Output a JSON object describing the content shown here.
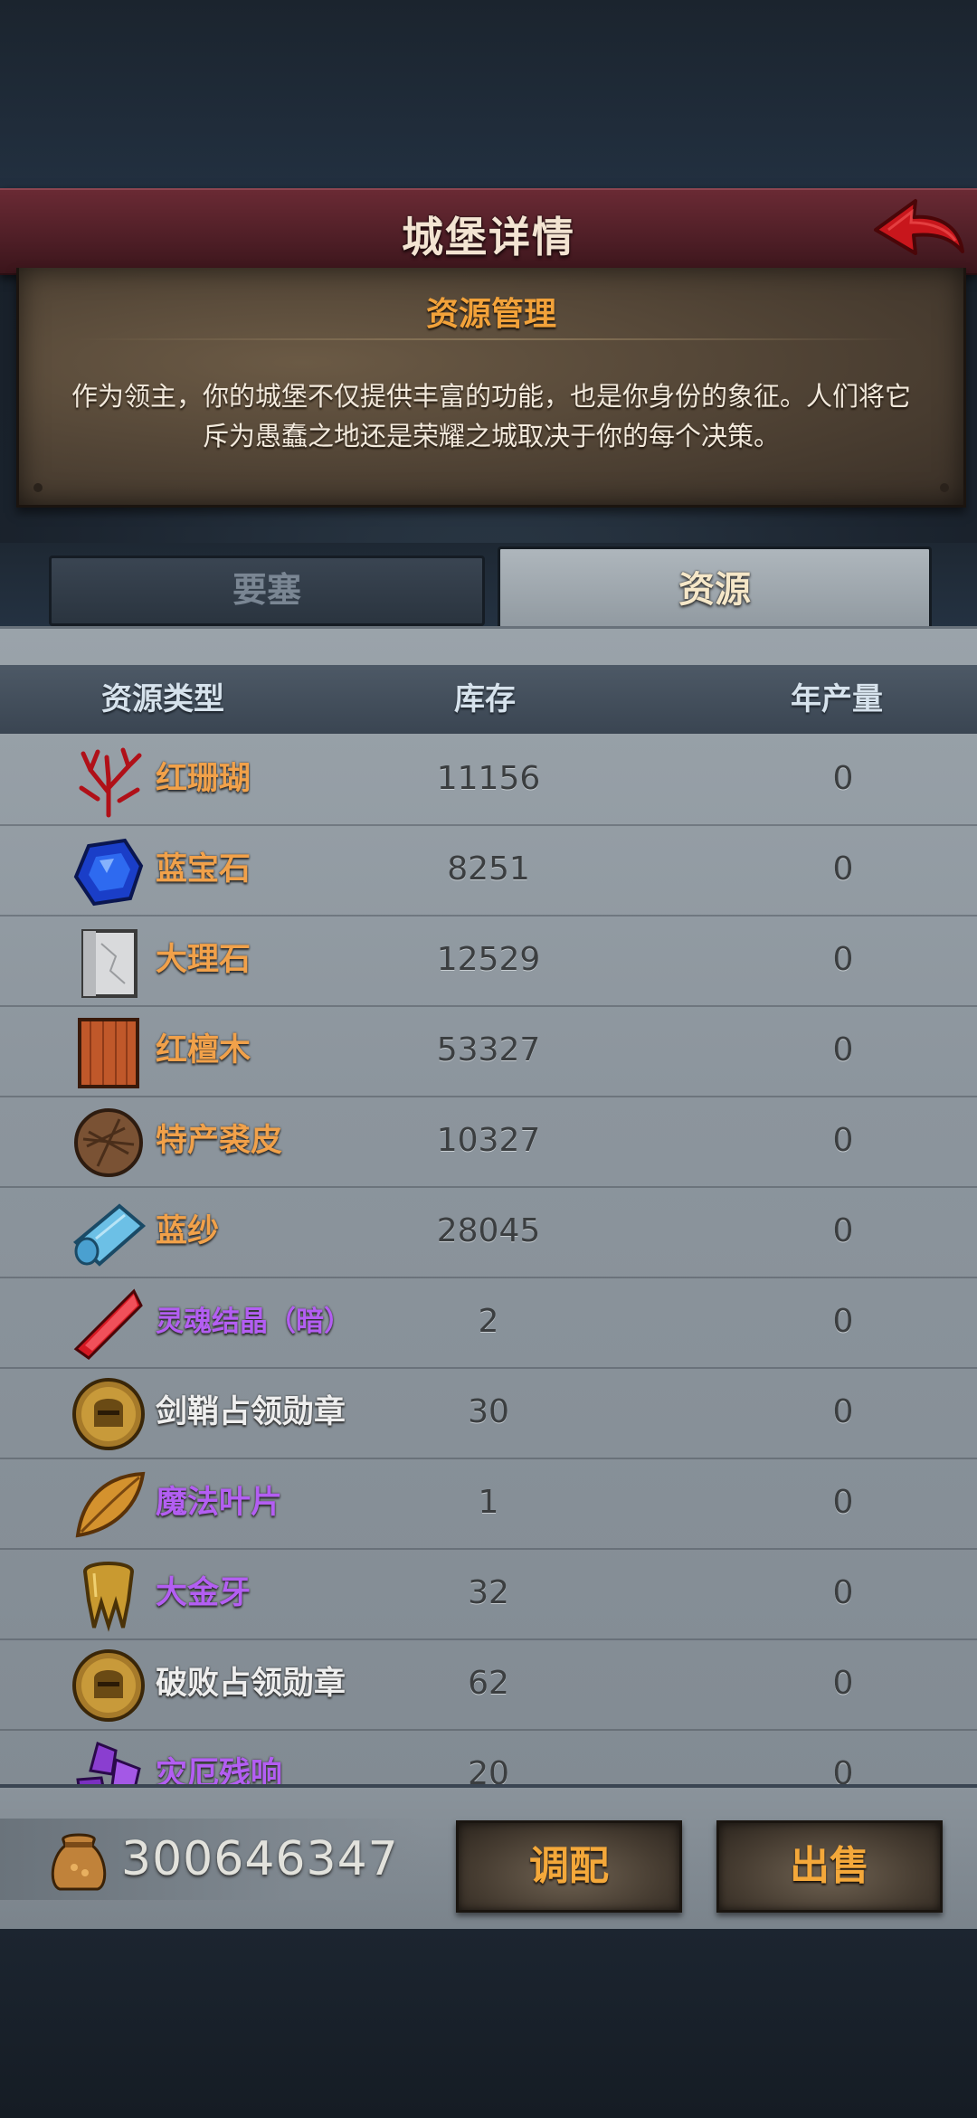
{
  "header": {
    "title": "城堡详情"
  },
  "banner": {
    "title": "资源管理",
    "description": "作为领主，你的城堡不仅提供丰富的功能，也是你身份的象征。人们将它斥为愚蠢之地还是荣耀之城取决于你的每个决策。"
  },
  "tabs": [
    {
      "label": "要塞",
      "active": false
    },
    {
      "label": "资源",
      "active": true
    }
  ],
  "table": {
    "headers": {
      "type": "资源类型",
      "stock": "库存",
      "yearly": "年产量"
    },
    "rows": [
      {
        "icon": "red-coral-icon",
        "name": "红珊瑚",
        "stock": "11156",
        "yearly": "0",
        "color": "#f1a14a"
      },
      {
        "icon": "sapphire-icon",
        "name": "蓝宝石",
        "stock": "8251",
        "yearly": "0",
        "color": "#f1a14a"
      },
      {
        "icon": "marble-icon",
        "name": "大理石",
        "stock": "12529",
        "yearly": "0",
        "color": "#f1a14a"
      },
      {
        "icon": "red-sandalwood-icon",
        "name": "红檀木",
        "stock": "53327",
        "yearly": "0",
        "color": "#f1a14a"
      },
      {
        "icon": "fur-pelt-icon",
        "name": "特产裘皮",
        "stock": "10327",
        "yearly": "0",
        "color": "#f1a14a"
      },
      {
        "icon": "blue-silk-icon",
        "name": "蓝纱",
        "stock": "28045",
        "yearly": "0",
        "color": "#f1a14a"
      },
      {
        "icon": "soul-crystal-icon",
        "name": "灵魂结晶（暗）",
        "stock": "2",
        "yearly": "0",
        "color": "#b35ef2"
      },
      {
        "icon": "helmet-medal-icon",
        "name": "剑鞘占领勋章",
        "stock": "30",
        "yearly": "0",
        "color": "#eeeeee"
      },
      {
        "icon": "magic-leaf-icon",
        "name": "魔法叶片",
        "stock": "1",
        "yearly": "0",
        "color": "#b35ef2"
      },
      {
        "icon": "gold-tooth-icon",
        "name": "大金牙",
        "stock": "32",
        "yearly": "0",
        "color": "#b35ef2"
      },
      {
        "icon": "helmet-medal-icon",
        "name": "破败占领勋章",
        "stock": "62",
        "yearly": "0",
        "color": "#eeeeee"
      },
      {
        "icon": "calamity-crystal-icon",
        "name": "灾厄残响",
        "stock": "20",
        "yearly": "0",
        "color": "#b35ef2"
      }
    ]
  },
  "footer": {
    "gold_icon": "gold-sack-icon",
    "gold_amount": "300646347",
    "allocate_label": "调配",
    "sell_label": "出售"
  }
}
